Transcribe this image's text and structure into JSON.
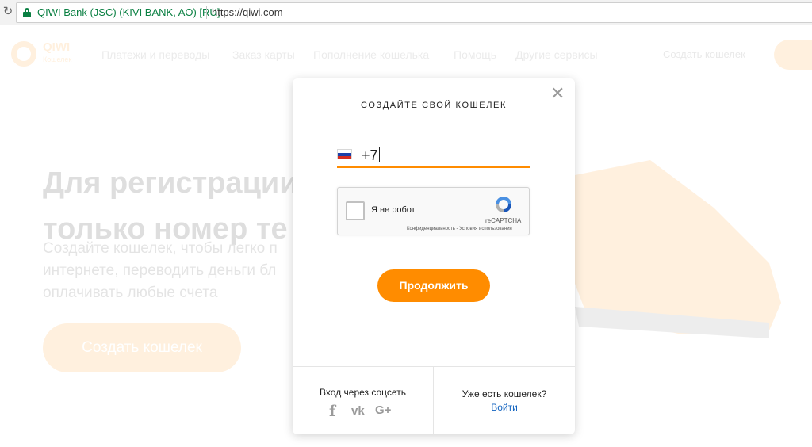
{
  "browser": {
    "site_identity": "QIWI Bank (JSC) (KIVI BANK, AO) [RU]",
    "url": "https://qiwi.com"
  },
  "header": {
    "logo_text": "QIWI",
    "logo_sub": "Кошелек",
    "nav": [
      "Платежи и переводы",
      "Заказ карты",
      "Пополнение кошелька",
      "Помощь",
      "Другие сервисы"
    ],
    "create_wallet_link": "Создать кошелек"
  },
  "hero": {
    "title_line1": "Для регистрации",
    "title_line2": "только номер те",
    "text_line1": "Создайте кошелек, чтобы легко п",
    "text_line2": "интернете, переводить деньги бл",
    "text_line3": "оплачивать любые счета",
    "button": "Создать кошелек"
  },
  "modal": {
    "title": "СОЗДАЙТЕ СВОЙ КОШЕЛЕК",
    "phone_prefix": "+7",
    "captcha": {
      "label": "Я не робот",
      "brand": "reCAPTCHA",
      "links": "Конфиденциальность - Условия использования"
    },
    "continue_button": "Продолжить",
    "social_login_label": "Вход через соцсеть",
    "social": [
      "f",
      "vk",
      "G+"
    ],
    "have_wallet_label": "Уже есть кошелек?",
    "login_link": "Войти"
  },
  "colors": {
    "accent": "#ff8c00",
    "link": "#1565c0",
    "secure": "#0b8043"
  }
}
